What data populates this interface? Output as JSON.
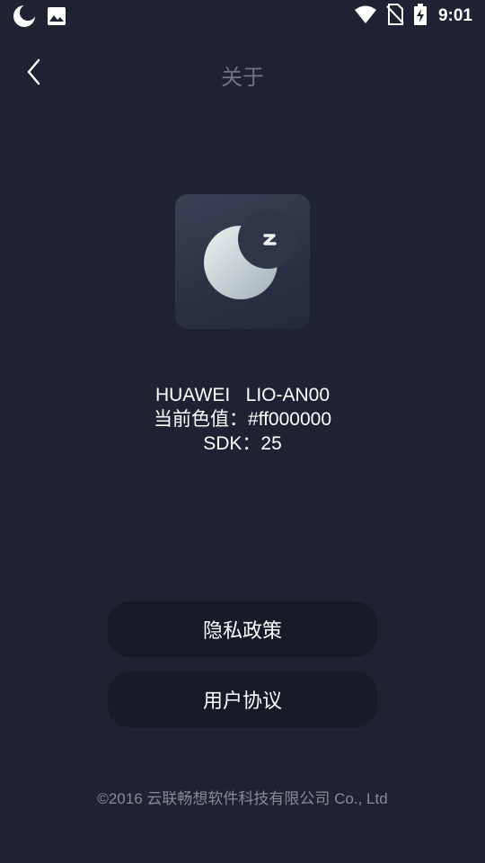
{
  "status_bar": {
    "time": "9:01",
    "icons": [
      "moon-app-icon",
      "gallery-icon",
      "wifi-icon",
      "no-sim-icon",
      "battery-charging-icon"
    ]
  },
  "nav": {
    "title": "关于",
    "back_icon": "chevron-left-icon"
  },
  "app_icon": {
    "icon": "moon-sleep-icon",
    "accent": "#dfe5e9"
  },
  "device_info": {
    "model": "HUAWEI   LIO-AN00",
    "color_value": "当前色值：#ff000000",
    "sdk": "SDK：25"
  },
  "actions": {
    "privacy_label": "隐私政策",
    "agreement_label": "用户协议"
  },
  "footer": {
    "copyright": "©2016 云联畅想软件科技有限公司 Co., Ltd"
  },
  "colors": {
    "background": "#1e2233",
    "button_bg": "#171b28",
    "title_text": "#6f7486",
    "footer_text": "#878b99"
  }
}
